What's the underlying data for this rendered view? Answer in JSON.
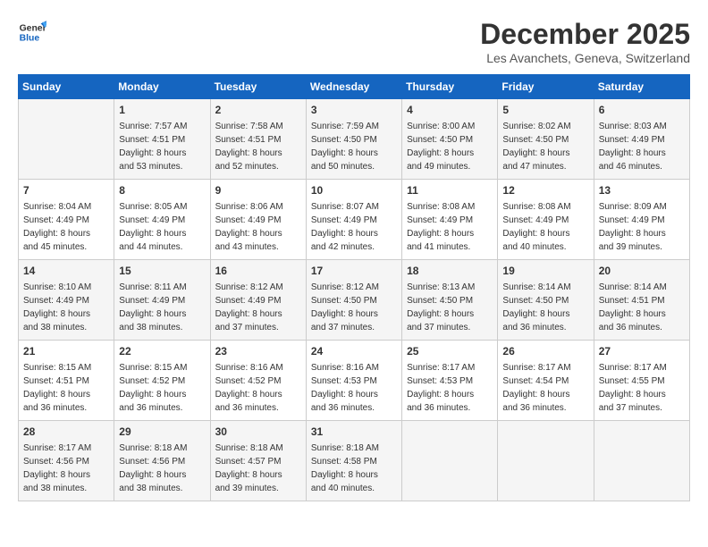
{
  "logo": {
    "line1": "General",
    "line2": "Blue"
  },
  "title": "December 2025",
  "subtitle": "Les Avanchets, Geneva, Switzerland",
  "days_of_week": [
    "Sunday",
    "Monday",
    "Tuesday",
    "Wednesday",
    "Thursday",
    "Friday",
    "Saturday"
  ],
  "weeks": [
    [
      {
        "day": "",
        "info": ""
      },
      {
        "day": "1",
        "info": "Sunrise: 7:57 AM\nSunset: 4:51 PM\nDaylight: 8 hours\nand 53 minutes."
      },
      {
        "day": "2",
        "info": "Sunrise: 7:58 AM\nSunset: 4:51 PM\nDaylight: 8 hours\nand 52 minutes."
      },
      {
        "day": "3",
        "info": "Sunrise: 7:59 AM\nSunset: 4:50 PM\nDaylight: 8 hours\nand 50 minutes."
      },
      {
        "day": "4",
        "info": "Sunrise: 8:00 AM\nSunset: 4:50 PM\nDaylight: 8 hours\nand 49 minutes."
      },
      {
        "day": "5",
        "info": "Sunrise: 8:02 AM\nSunset: 4:50 PM\nDaylight: 8 hours\nand 47 minutes."
      },
      {
        "day": "6",
        "info": "Sunrise: 8:03 AM\nSunset: 4:49 PM\nDaylight: 8 hours\nand 46 minutes."
      }
    ],
    [
      {
        "day": "7",
        "info": "Sunrise: 8:04 AM\nSunset: 4:49 PM\nDaylight: 8 hours\nand 45 minutes."
      },
      {
        "day": "8",
        "info": "Sunrise: 8:05 AM\nSunset: 4:49 PM\nDaylight: 8 hours\nand 44 minutes."
      },
      {
        "day": "9",
        "info": "Sunrise: 8:06 AM\nSunset: 4:49 PM\nDaylight: 8 hours\nand 43 minutes."
      },
      {
        "day": "10",
        "info": "Sunrise: 8:07 AM\nSunset: 4:49 PM\nDaylight: 8 hours\nand 42 minutes."
      },
      {
        "day": "11",
        "info": "Sunrise: 8:08 AM\nSunset: 4:49 PM\nDaylight: 8 hours\nand 41 minutes."
      },
      {
        "day": "12",
        "info": "Sunrise: 8:08 AM\nSunset: 4:49 PM\nDaylight: 8 hours\nand 40 minutes."
      },
      {
        "day": "13",
        "info": "Sunrise: 8:09 AM\nSunset: 4:49 PM\nDaylight: 8 hours\nand 39 minutes."
      }
    ],
    [
      {
        "day": "14",
        "info": "Sunrise: 8:10 AM\nSunset: 4:49 PM\nDaylight: 8 hours\nand 38 minutes."
      },
      {
        "day": "15",
        "info": "Sunrise: 8:11 AM\nSunset: 4:49 PM\nDaylight: 8 hours\nand 38 minutes."
      },
      {
        "day": "16",
        "info": "Sunrise: 8:12 AM\nSunset: 4:49 PM\nDaylight: 8 hours\nand 37 minutes."
      },
      {
        "day": "17",
        "info": "Sunrise: 8:12 AM\nSunset: 4:50 PM\nDaylight: 8 hours\nand 37 minutes."
      },
      {
        "day": "18",
        "info": "Sunrise: 8:13 AM\nSunset: 4:50 PM\nDaylight: 8 hours\nand 37 minutes."
      },
      {
        "day": "19",
        "info": "Sunrise: 8:14 AM\nSunset: 4:50 PM\nDaylight: 8 hours\nand 36 minutes."
      },
      {
        "day": "20",
        "info": "Sunrise: 8:14 AM\nSunset: 4:51 PM\nDaylight: 8 hours\nand 36 minutes."
      }
    ],
    [
      {
        "day": "21",
        "info": "Sunrise: 8:15 AM\nSunset: 4:51 PM\nDaylight: 8 hours\nand 36 minutes."
      },
      {
        "day": "22",
        "info": "Sunrise: 8:15 AM\nSunset: 4:52 PM\nDaylight: 8 hours\nand 36 minutes."
      },
      {
        "day": "23",
        "info": "Sunrise: 8:16 AM\nSunset: 4:52 PM\nDaylight: 8 hours\nand 36 minutes."
      },
      {
        "day": "24",
        "info": "Sunrise: 8:16 AM\nSunset: 4:53 PM\nDaylight: 8 hours\nand 36 minutes."
      },
      {
        "day": "25",
        "info": "Sunrise: 8:17 AM\nSunset: 4:53 PM\nDaylight: 8 hours\nand 36 minutes."
      },
      {
        "day": "26",
        "info": "Sunrise: 8:17 AM\nSunset: 4:54 PM\nDaylight: 8 hours\nand 36 minutes."
      },
      {
        "day": "27",
        "info": "Sunrise: 8:17 AM\nSunset: 4:55 PM\nDaylight: 8 hours\nand 37 minutes."
      }
    ],
    [
      {
        "day": "28",
        "info": "Sunrise: 8:17 AM\nSunset: 4:56 PM\nDaylight: 8 hours\nand 38 minutes."
      },
      {
        "day": "29",
        "info": "Sunrise: 8:18 AM\nSunset: 4:56 PM\nDaylight: 8 hours\nand 38 minutes."
      },
      {
        "day": "30",
        "info": "Sunrise: 8:18 AM\nSunset: 4:57 PM\nDaylight: 8 hours\nand 39 minutes."
      },
      {
        "day": "31",
        "info": "Sunrise: 8:18 AM\nSunset: 4:58 PM\nDaylight: 8 hours\nand 40 minutes."
      },
      {
        "day": "",
        "info": ""
      },
      {
        "day": "",
        "info": ""
      },
      {
        "day": "",
        "info": ""
      }
    ]
  ]
}
